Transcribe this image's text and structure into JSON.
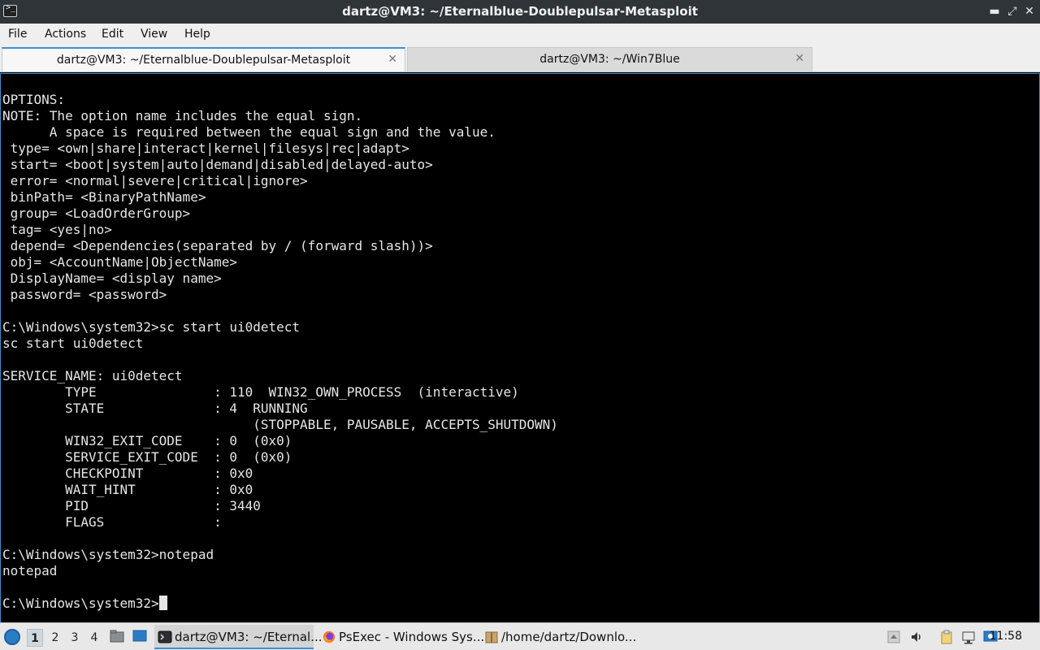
{
  "window": {
    "title": "dartz@VM3: ~/Eternalblue-Doublepulsar-Metasploit",
    "controls": {
      "minimize": "▬",
      "maximize": "⤢",
      "close": "✕"
    }
  },
  "menu": {
    "items": [
      {
        "label": "File"
      },
      {
        "label": "Actions"
      },
      {
        "label": "Edit"
      },
      {
        "label": "View"
      },
      {
        "label": "Help"
      }
    ]
  },
  "tabs": [
    {
      "label": "dartz@VM3: ~/Eternalblue-Doublepulsar-Metasploit",
      "active": true,
      "close": "✕"
    },
    {
      "label": "dartz@VM3: ~/Win7Blue",
      "active": false,
      "close": "✕"
    }
  ],
  "terminal": {
    "output": "OPTIONS:\nNOTE: The option name includes the equal sign.\n      A space is required between the equal sign and the value.\n type= <own|share|interact|kernel|filesys|rec|adapt>\n start= <boot|system|auto|demand|disabled|delayed-auto>\n error= <normal|severe|critical|ignore>\n binPath= <BinaryPathName>\n group= <LoadOrderGroup>\n tag= <yes|no>\n depend= <Dependencies(separated by / (forward slash))>\n obj= <AccountName|ObjectName>\n DisplayName= <display name>\n password= <password>\n\nC:\\Windows\\system32>sc start ui0detect\nsc start ui0detect\n\nSERVICE_NAME: ui0detect\n        TYPE               : 110  WIN32_OWN_PROCESS  (interactive)\n        STATE              : 4  RUNNING\n                                (STOPPABLE, PAUSABLE, ACCEPTS_SHUTDOWN)\n        WIN32_EXIT_CODE    : 0  (0x0)\n        SERVICE_EXIT_CODE  : 0  (0x0)\n        CHECKPOINT         : 0x0\n        WAIT_HINT          : 0x0\n        PID                : 3440\n        FLAGS              :\n\nC:\\Windows\\system32>notepad\nnotepad\n\n",
    "prompt": "C:\\Windows\\system32>"
  },
  "taskbar": {
    "workspaces": [
      "1",
      "2",
      "3",
      "4"
    ],
    "active_workspace": "1",
    "tasks": [
      {
        "label": "dartz@VM3: ~/Eternal...",
        "icon": "terminal-icon",
        "active": true
      },
      {
        "label": "PsExec - Windows Sys...",
        "icon": "firefox-icon",
        "active": false
      },
      {
        "label": "/home/dartz/Downlo...",
        "icon": "archive-icon",
        "active": false
      }
    ],
    "clock": "11:58"
  },
  "colors": {
    "accent": "#3c8ed4",
    "terminal_bg": "#000000",
    "terminal_fg": "#e6e6e6",
    "titlebar_bg": "#2f3439"
  }
}
